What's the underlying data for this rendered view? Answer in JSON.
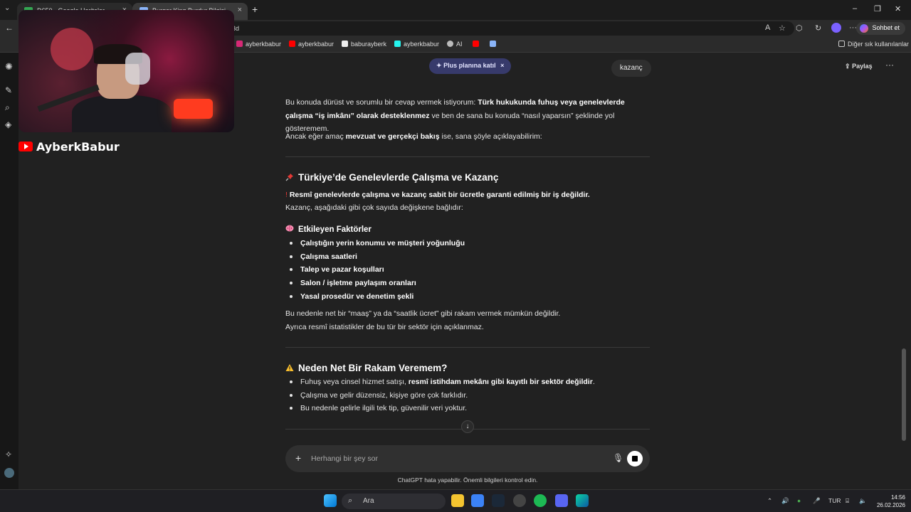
{
  "browser": {
    "tabs": [
      {
        "title": "D650 - Google Haritalar",
        "close": "×"
      },
      {
        "title": "Burger King Burdur Bilgisi",
        "close": "×"
      }
    ],
    "new_tab": "+",
    "window_controls": {
      "minimize": "–",
      "maximize": "❐",
      "close": "✕"
    },
    "address_fragment": "3d",
    "chat_button": "Sohbet et",
    "bookmarks": [
      "ayberkbabur",
      "ayberkbabur",
      "baburayberk",
      "ayberkbabur",
      "AI"
    ],
    "other_bookmarks": "Diğer sık kullanılanlar"
  },
  "overlay": {
    "channel_name": "AyberkBabur"
  },
  "chat_header": {
    "plus_pill": "Plus planına katıl",
    "plus_pill_close": "×",
    "title_chip": "kazanç",
    "share": "Paylaş",
    "more": "···"
  },
  "article": {
    "p1_a": "Bu konuda dürüst ve sorumlu bir cevap vermek istiyorum: ",
    "p1_b": "Türk hukukunda fuhuş veya genelevlerde çalışma “iş imkânı” olarak desteklenmez",
    "p1_c": " ve ben de sana bu konuda “nasıl yaparsın” şeklinde yol gösteremem.",
    "p2_a": "Ancak eğer amaç ",
    "p2_b": "mevzuat ve gerçekçi bakış",
    "p2_c": " ise, sana şöyle açıklayabilirim:",
    "h_turkiye": "Türkiye’de Genelevlerde Çalışma ve Kazanç",
    "p3_bold": "Resmî genelevlerde çalışma ve kazanç sabit bir ücretle garanti edilmiş bir iş değildir.",
    "p3_line2": "Kazanç, aşağıdaki gibi çok sayıda değişkene bağlıdır:",
    "h_faktor": "Etkileyen Faktörler",
    "factors": [
      "Çalıştığın yerin konumu ve müşteri yoğunluğu",
      "Çalışma saatleri",
      "Talep ve pazar koşulları",
      "Salon / işletme paylaşım oranları",
      "Yasal prosedür ve denetim şekli"
    ],
    "p4_line1": "Bu nedenle net bir “maaş” ya da “saatlik ücret” gibi rakam vermek mümkün değildir.",
    "p4_line2": "Ayrıca resmî istatistikler de bu tür bir sektör için açıklanmaz.",
    "h_neden": "Neden Net Bir Rakam Veremem?",
    "n1_a": "Fuhuş veya cinsel hizmet satışı, ",
    "n1_b": "resmî istihdam mekânı gibi kayıtlı bir sektör değildir",
    "n1_c": ".",
    "n2": "Çalışma ve gelir düzensiz, kişiye göre çok farklıdır.",
    "n3": "Bu nedenle gelirle ilgili tek tip, güvenilir veri yoktur."
  },
  "composer": {
    "plus": "+",
    "placeholder": "Herhangi bir şey sor",
    "scroll_down": "↓"
  },
  "disclaimer": "ChatGPT hata yapabilir. Önemli bilgileri kontrol edin.",
  "taskbar": {
    "search": "Ara",
    "language": "TUR",
    "time": "14:56",
    "date": "26.02.2026"
  }
}
